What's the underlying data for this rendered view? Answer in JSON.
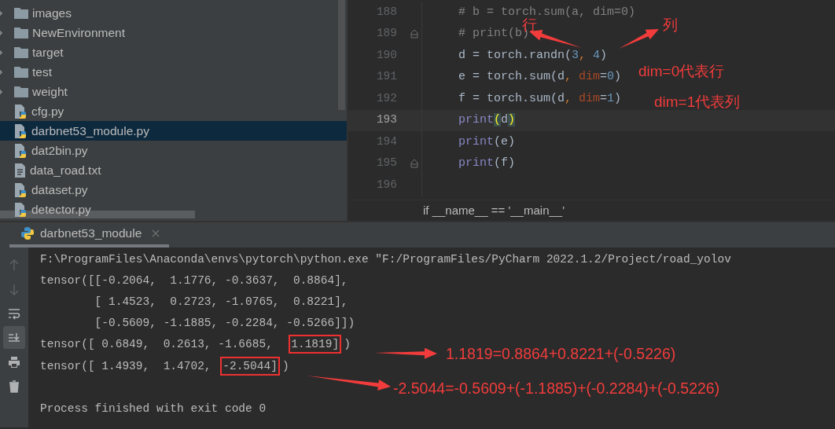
{
  "project_tree": {
    "items": [
      {
        "name": "images",
        "kind": "folder",
        "selected": false
      },
      {
        "name": "NewEnvironment",
        "kind": "folder",
        "selected": false
      },
      {
        "name": "target",
        "kind": "folder",
        "selected": false
      },
      {
        "name": "test",
        "kind": "folder",
        "selected": false
      },
      {
        "name": "weight",
        "kind": "folder",
        "selected": false
      },
      {
        "name": "cfg.py",
        "kind": "python",
        "selected": false
      },
      {
        "name": "darbnet53_module.py",
        "kind": "python",
        "selected": true
      },
      {
        "name": "dat2bin.py",
        "kind": "python",
        "selected": false
      },
      {
        "name": "data_road.txt",
        "kind": "text",
        "selected": false
      },
      {
        "name": "dataset.py",
        "kind": "python",
        "selected": false
      },
      {
        "name": "detector.py",
        "kind": "python",
        "selected": false
      }
    ]
  },
  "editor": {
    "lines": [
      {
        "number": "188",
        "current": false,
        "fold_marker": false,
        "tokens": [
          {
            "text": "# b = torch.sum(a, dim=0)",
            "kind": "comment"
          }
        ]
      },
      {
        "number": "189",
        "current": false,
        "fold_marker": true,
        "tokens": [
          {
            "text": "# print(b)",
            "kind": "comment"
          }
        ]
      },
      {
        "number": "190",
        "current": false,
        "fold_marker": false,
        "tokens": [
          {
            "text": "d = torch.randn(",
            "kind": "plain"
          },
          {
            "text": "3",
            "kind": "number"
          },
          {
            "text": ", ",
            "kind": "punct"
          },
          {
            "text": "4",
            "kind": "number"
          },
          {
            "text": ")",
            "kind": "plain"
          }
        ]
      },
      {
        "number": "191",
        "current": false,
        "fold_marker": false,
        "tokens": [
          {
            "text": "e = torch.sum(d",
            "kind": "plain"
          },
          {
            "text": ", ",
            "kind": "punct"
          },
          {
            "text": "dim",
            "kind": "param"
          },
          {
            "text": "=",
            "kind": "plain"
          },
          {
            "text": "0",
            "kind": "number"
          },
          {
            "text": ")",
            "kind": "plain"
          }
        ]
      },
      {
        "number": "192",
        "current": false,
        "fold_marker": false,
        "tokens": [
          {
            "text": "f = torch.sum(d",
            "kind": "plain"
          },
          {
            "text": ", ",
            "kind": "punct"
          },
          {
            "text": "dim",
            "kind": "param"
          },
          {
            "text": "=",
            "kind": "plain"
          },
          {
            "text": "1",
            "kind": "number"
          },
          {
            "text": ")",
            "kind": "plain"
          }
        ]
      },
      {
        "number": "193",
        "current": true,
        "fold_marker": false,
        "tokens": [
          {
            "text": "print",
            "kind": "builtin"
          },
          {
            "text": "(",
            "kind": "brace_match"
          },
          {
            "text": "d",
            "kind": "plain"
          },
          {
            "text": ")",
            "kind": "brace_match"
          }
        ]
      },
      {
        "number": "194",
        "current": false,
        "fold_marker": false,
        "tokens": [
          {
            "text": "print",
            "kind": "builtin"
          },
          {
            "text": "(e)",
            "kind": "plain"
          }
        ]
      },
      {
        "number": "195",
        "current": false,
        "fold_marker": true,
        "tokens": [
          {
            "text": "print",
            "kind": "builtin"
          },
          {
            "text": "(f)",
            "kind": "plain"
          }
        ]
      },
      {
        "number": "196",
        "current": false,
        "fold_marker": false
      }
    ],
    "breadcrumb": "if __name__ == '__main__'"
  },
  "run_panel": {
    "tab": {
      "label": "darbnet53_module",
      "selected": true
    },
    "toolbar": [
      {
        "kind": "up",
        "disabled": true,
        "selected": false
      },
      {
        "kind": "down",
        "disabled": true,
        "selected": false
      },
      {
        "kind": "wrap",
        "disabled": false,
        "selected": false
      },
      {
        "kind": "scroll_end",
        "disabled": false,
        "selected": true
      },
      {
        "kind": "print",
        "disabled": false,
        "selected": false
      },
      {
        "kind": "trash",
        "disabled": false,
        "selected": false
      }
    ],
    "console": [
      {
        "kind": "text",
        "segments": [
          {
            "text": "F:\\ProgramFiles\\Anaconda\\envs\\pytorch\\python.exe \"F:/ProgramFiles/PyCharm 2022.1.2/Project/road_yolov",
            "boxed": false
          }
        ]
      },
      {
        "kind": "text",
        "segments": [
          {
            "text": "tensor([[-0.2064,  1.1776, -0.3637,  0.8864],",
            "boxed": false
          }
        ]
      },
      {
        "kind": "text",
        "segments": [
          {
            "text": "        [ 1.4523,  0.2723, -1.0765,  0.8221],",
            "boxed": false
          }
        ]
      },
      {
        "kind": "text",
        "segments": [
          {
            "text": "        [-0.5609, -1.1885, -0.2284, -0.5266]])",
            "boxed": false
          }
        ]
      },
      {
        "kind": "text",
        "segments": [
          {
            "text": "tensor([ 0.6849,  0.2613, -1.6685,  ",
            "boxed": false
          },
          {
            "text": "1.1819]",
            "boxed": true
          },
          {
            "text": ")",
            "boxed": false
          }
        ]
      },
      {
        "kind": "text",
        "segments": [
          {
            "text": "tensor([ 1.4939,  1.4702, ",
            "boxed": false
          },
          {
            "text": "-2.5044]",
            "boxed": true
          },
          {
            "text": ")",
            "boxed": false
          }
        ]
      },
      {
        "kind": "blank"
      },
      {
        "kind": "text",
        "segments": [
          {
            "text": "Process finished with exit code 0",
            "boxed": false
          }
        ]
      }
    ]
  },
  "annotations": [
    "行",
    "列",
    "dim=0代表行",
    "dim=1代表列",
    "1.1819=0.8864+0.8221+(-0.5226)",
    "-2.5044=-0.5609+(-1.1885)+(-0.2284)+(-0.5226)"
  ]
}
